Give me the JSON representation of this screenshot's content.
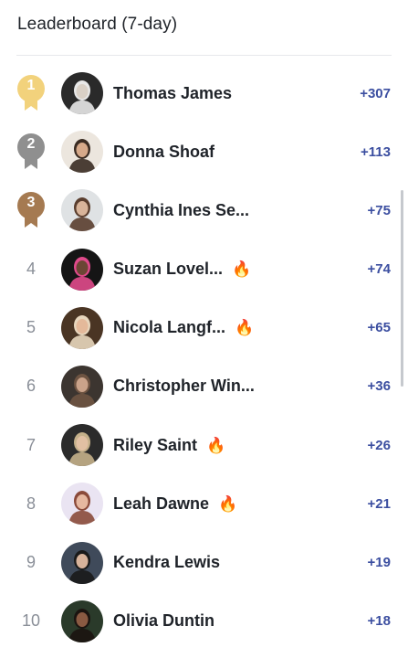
{
  "header": {
    "title": "Leaderboard (7-day)"
  },
  "colors": {
    "gold": "#f2d27c",
    "silver": "#8f8f8f",
    "bronze": "#a57a51",
    "score": "#3b4ea0",
    "fire": "#f4511e"
  },
  "rows": [
    {
      "rank": "1",
      "medal": "gold",
      "name": "Thomas James",
      "fire": false,
      "score": "+307",
      "avatar_icon": "avatar-photo-dark"
    },
    {
      "rank": "2",
      "medal": "silver",
      "name": "Donna Shoaf",
      "fire": false,
      "score": "+113",
      "avatar_icon": "avatar-photo-light"
    },
    {
      "rank": "3",
      "medal": "bronze",
      "name": "Cynthia Ines Se...",
      "fire": false,
      "score": "+75",
      "avatar_icon": "avatar-photo-light"
    },
    {
      "rank": "4",
      "medal": null,
      "name": "Suzan Lovel...",
      "fire": true,
      "fire_icon": "🔥",
      "score": "+74",
      "avatar_icon": "avatar-photo-dark"
    },
    {
      "rank": "5",
      "medal": null,
      "name": "Nicola Langf...",
      "fire": true,
      "fire_icon": "🔥",
      "score": "+65",
      "avatar_icon": "avatar-photo-warm"
    },
    {
      "rank": "6",
      "medal": null,
      "name": "Christopher Win...",
      "fire": false,
      "score": "+36",
      "avatar_icon": "avatar-photo-dark"
    },
    {
      "rank": "7",
      "medal": null,
      "name": "Riley Saint",
      "fire": true,
      "fire_icon": "🔥",
      "score": "+26",
      "avatar_icon": "avatar-photo-dark"
    },
    {
      "rank": "8",
      "medal": null,
      "name": "Leah Dawne",
      "fire": true,
      "fire_icon": "🔥",
      "score": "+21",
      "avatar_icon": "avatar-photo-light"
    },
    {
      "rank": "9",
      "medal": null,
      "name": "Kendra Lewis",
      "fire": false,
      "score": "+19",
      "avatar_icon": "avatar-photo-light"
    },
    {
      "rank": "10",
      "medal": null,
      "name": "Olivia Duntin",
      "fire": false,
      "score": "+18",
      "avatar_icon": "avatar-photo-dark"
    }
  ]
}
